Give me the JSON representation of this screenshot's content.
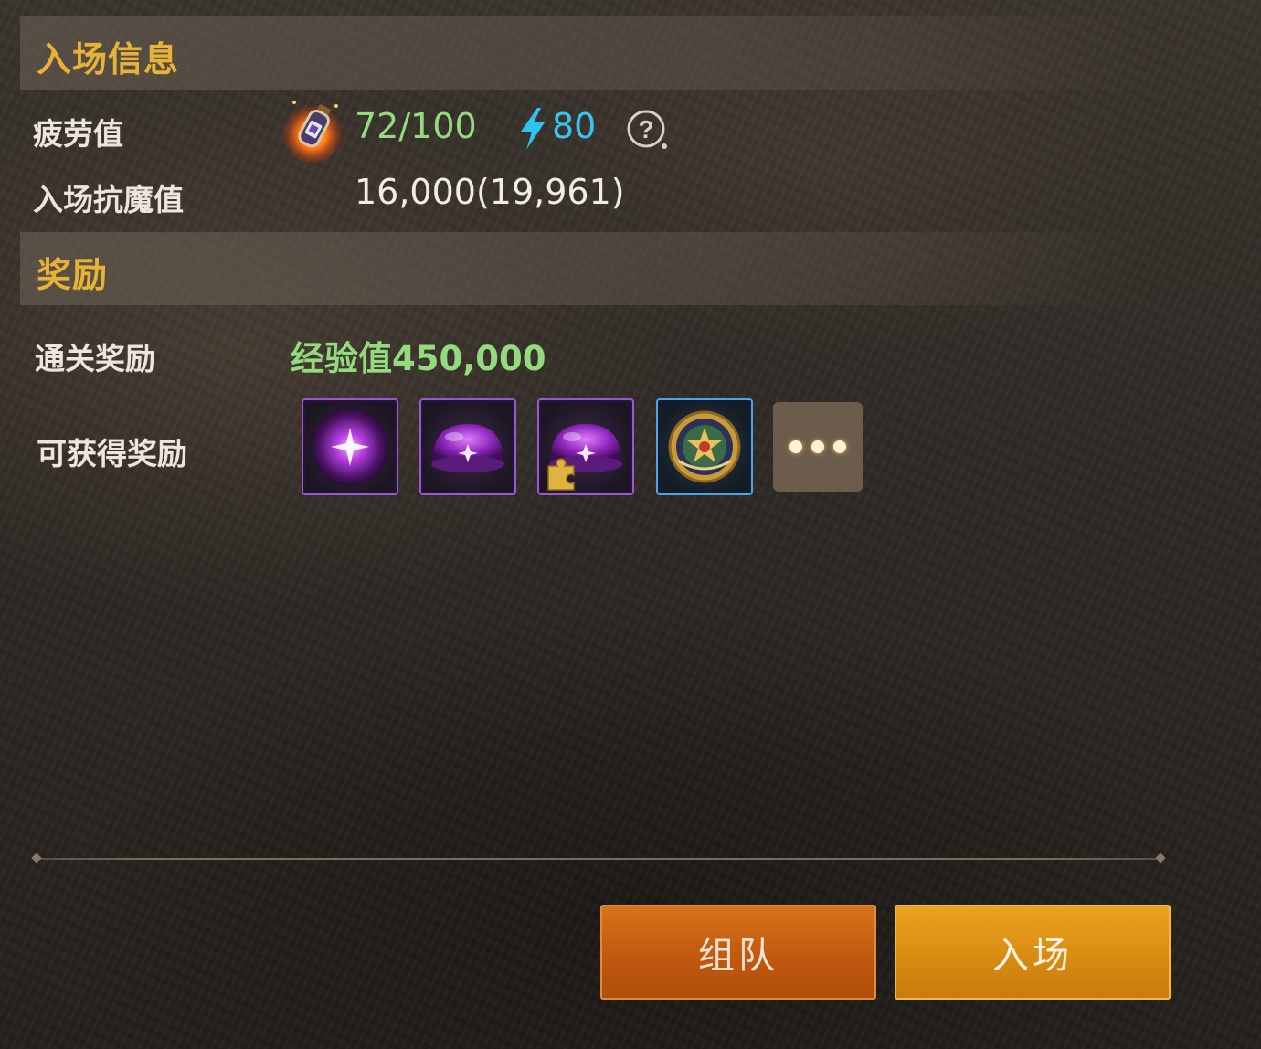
{
  "entry_info": {
    "title": "入场信息",
    "fatigue": {
      "label": "疲劳值",
      "value": "72/100",
      "energy_value": "80",
      "potion_icon": "fatigue-potion-icon",
      "energy_icon": "lightning-icon",
      "help_icon": "question-mark-icon"
    },
    "resistance": {
      "label": "入场抗魔值",
      "value": "16,000(19,961)"
    }
  },
  "rewards": {
    "title": "奖励",
    "clear_reward": {
      "label": "通关奖励",
      "value": "经验值450,000"
    },
    "obtainable": {
      "label": "可获得奖励",
      "items": [
        {
          "icon": "purple-orb-icon",
          "rarity": "purple"
        },
        {
          "icon": "purple-pudding-icon",
          "rarity": "purple"
        },
        {
          "icon": "purple-pudding-fragment-icon",
          "rarity": "purple"
        },
        {
          "icon": "gold-medal-icon",
          "rarity": "blue"
        }
      ],
      "more_icon": "more-dots-icon"
    }
  },
  "buttons": {
    "team_label": "组队",
    "enter_label": "入场"
  },
  "colors": {
    "section_title": "#e8b236",
    "green_value": "#93db7e",
    "cyan_value": "#34c6ef",
    "purple_frame": "#9a57d3",
    "blue_frame": "#4fa3e6",
    "team_button": "#c1580f",
    "enter_button": "#d98c12"
  }
}
